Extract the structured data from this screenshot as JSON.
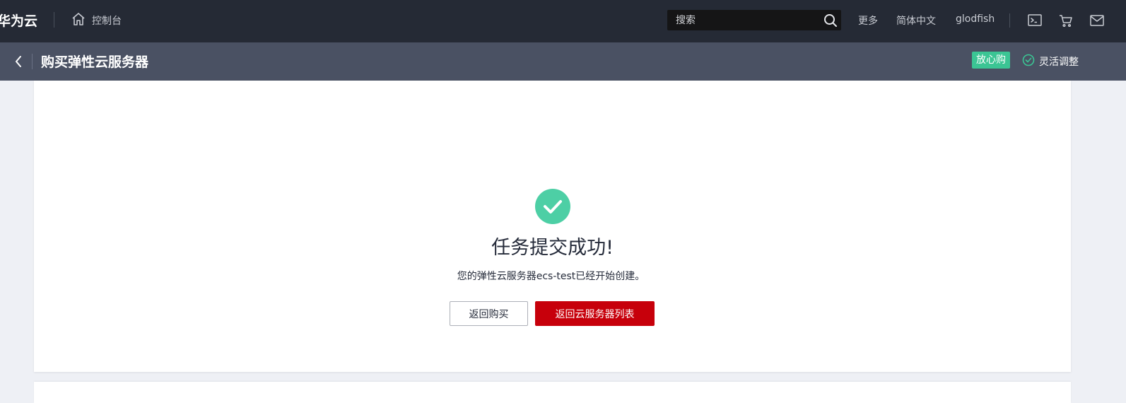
{
  "header": {
    "brand": "华为云",
    "console_label": "控制台",
    "search_placeholder": "搜索",
    "more": "更多",
    "language": "简体中文",
    "username": "glodfish"
  },
  "subheader": {
    "title": "购买弹性云服务器",
    "badge": "放心购",
    "flex_adjust": "灵活调整"
  },
  "result": {
    "title": "任务提交成功!",
    "description": "您的弹性云服务器ecs-test已经开始创建。",
    "back_to_purchase": "返回购买",
    "back_to_list": "返回云服务器列表"
  },
  "icons": {
    "home": "home-icon",
    "search": "search-icon",
    "terminal": "terminal-icon",
    "cart": "cart-icon",
    "mail": "mail-icon",
    "back": "chevron-left-icon",
    "check_circle": "check-circle-icon",
    "success": "success-check-icon"
  },
  "colors": {
    "topbar": "#252a35",
    "subbar": "#4a5163",
    "badge": "#3bc594",
    "success": "#4dcfa5",
    "primary_button": "#c7000b"
  }
}
